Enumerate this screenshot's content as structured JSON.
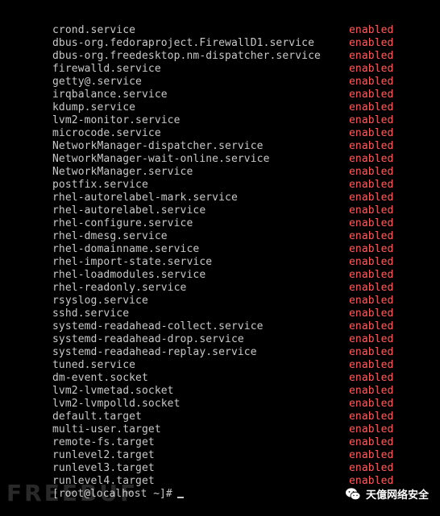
{
  "terminal": {
    "rows": [
      {
        "unit": "crond.service",
        "state": "enabled"
      },
      {
        "unit": "dbus-org.fedoraproject.FirewallD1.service",
        "state": "enabled"
      },
      {
        "unit": "dbus-org.freedesktop.nm-dispatcher.service",
        "state": "enabled"
      },
      {
        "unit": "firewalld.service",
        "state": "enabled"
      },
      {
        "unit": "getty@.service",
        "state": "enabled"
      },
      {
        "unit": "irqbalance.service",
        "state": "enabled"
      },
      {
        "unit": "kdump.service",
        "state": "enabled"
      },
      {
        "unit": "lvm2-monitor.service",
        "state": "enabled"
      },
      {
        "unit": "microcode.service",
        "state": "enabled"
      },
      {
        "unit": "NetworkManager-dispatcher.service",
        "state": "enabled"
      },
      {
        "unit": "NetworkManager-wait-online.service",
        "state": "enabled"
      },
      {
        "unit": "NetworkManager.service",
        "state": "enabled"
      },
      {
        "unit": "postfix.service",
        "state": "enabled"
      },
      {
        "unit": "rhel-autorelabel-mark.service",
        "state": "enabled"
      },
      {
        "unit": "rhel-autorelabel.service",
        "state": "enabled"
      },
      {
        "unit": "rhel-configure.service",
        "state": "enabled"
      },
      {
        "unit": "rhel-dmesg.service",
        "state": "enabled"
      },
      {
        "unit": "rhel-domainname.service",
        "state": "enabled"
      },
      {
        "unit": "rhel-import-state.service",
        "state": "enabled"
      },
      {
        "unit": "rhel-loadmodules.service",
        "state": "enabled"
      },
      {
        "unit": "rhel-readonly.service",
        "state": "enabled"
      },
      {
        "unit": "rsyslog.service",
        "state": "enabled"
      },
      {
        "unit": "sshd.service",
        "state": "enabled"
      },
      {
        "unit": "systemd-readahead-collect.service",
        "state": "enabled"
      },
      {
        "unit": "systemd-readahead-drop.service",
        "state": "enabled"
      },
      {
        "unit": "systemd-readahead-replay.service",
        "state": "enabled"
      },
      {
        "unit": "tuned.service",
        "state": "enabled"
      },
      {
        "unit": "dm-event.socket",
        "state": "enabled"
      },
      {
        "unit": "lvm2-lvmetad.socket",
        "state": "enabled"
      },
      {
        "unit": "lvm2-lvmpolld.socket",
        "state": "enabled"
      },
      {
        "unit": "default.target",
        "state": "enabled"
      },
      {
        "unit": "multi-user.target",
        "state": "enabled"
      },
      {
        "unit": "remote-fs.target",
        "state": "enabled"
      },
      {
        "unit": "runlevel2.target",
        "state": "enabled"
      },
      {
        "unit": "runlevel3.target",
        "state": "enabled"
      },
      {
        "unit": "runlevel4.target",
        "state": "enabled"
      }
    ],
    "prompt": "[root@localhost ~]#"
  },
  "watermark": {
    "left_text": "FREEBUF",
    "right_text": "天億网络安全",
    "right_icon": "wechat-icon"
  },
  "colors": {
    "background": "#000000",
    "text": "#c8c8c8",
    "enabled": "#ff5c5c"
  }
}
